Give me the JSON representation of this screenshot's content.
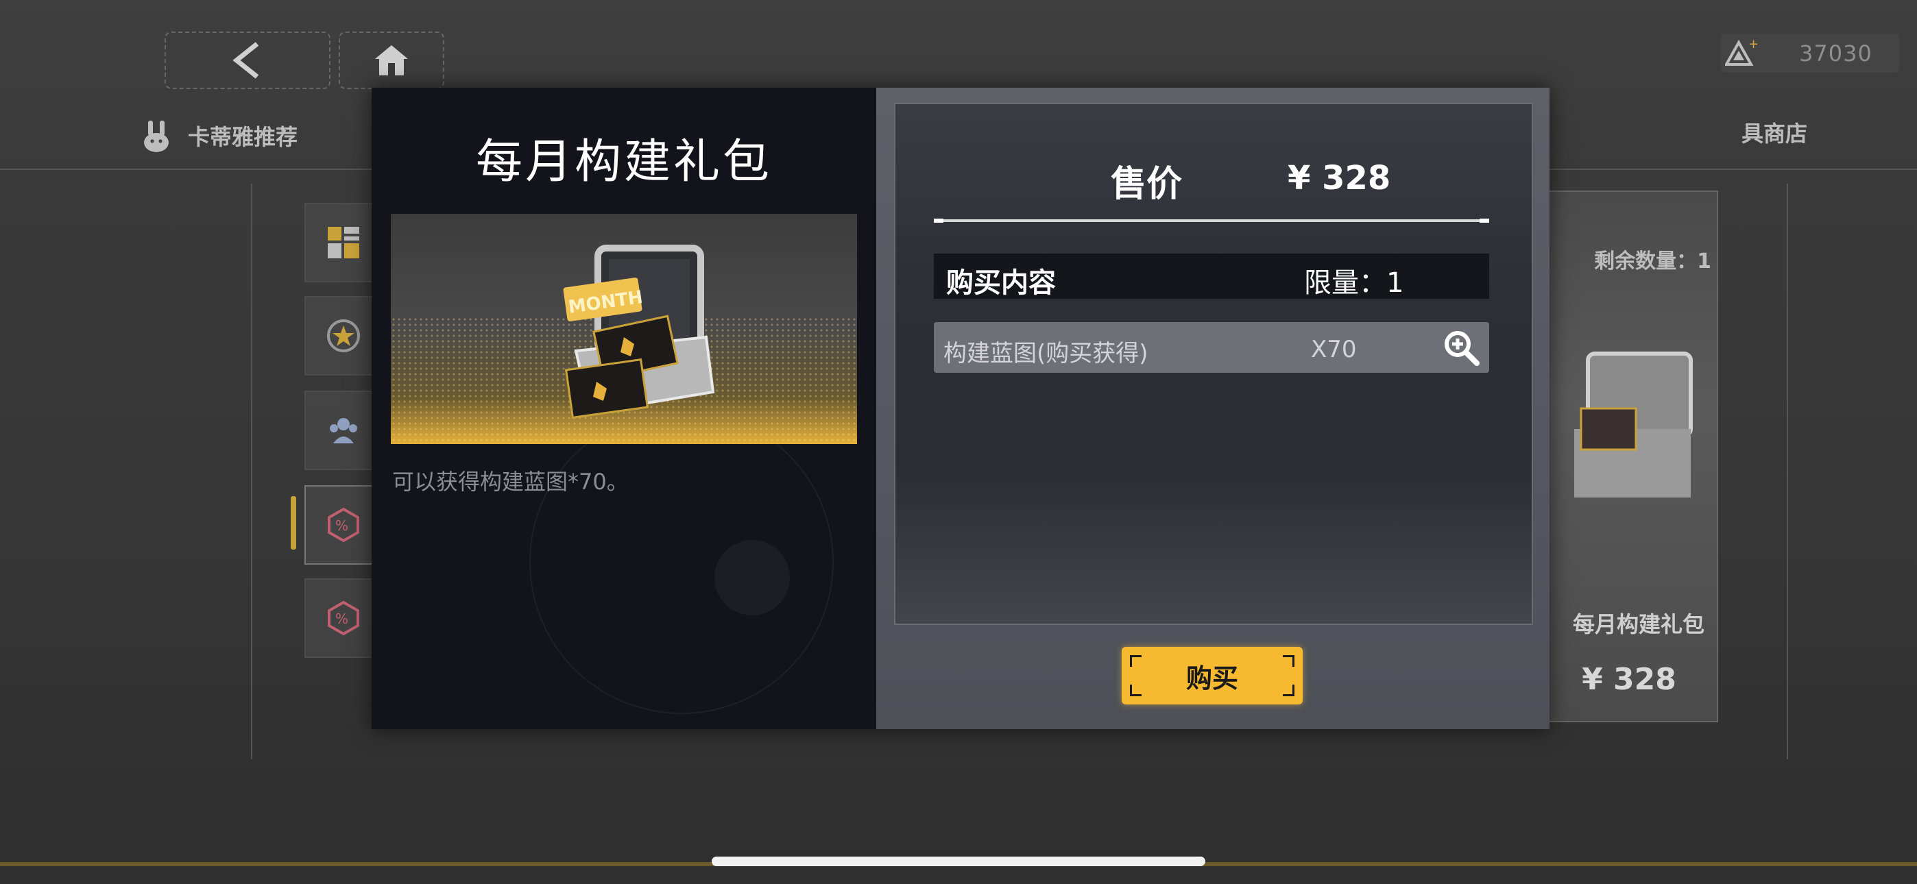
{
  "currency": {
    "amount": "37030",
    "icon": "triangle-token-icon"
  },
  "background": {
    "tab_left": "卡蒂雅推荐",
    "tab_right": "具商店",
    "card": {
      "remaining": "剩余数量：1",
      "name": "每月构建礼包",
      "price": "¥ 328"
    }
  },
  "modal": {
    "title": "每月构建礼包",
    "image_badge": "MONTH",
    "description": "可以获得构建蓝图*70。",
    "price_label": "售价",
    "price_value": "¥ 328",
    "contents_label": "购买内容",
    "limit_text": "限量：1",
    "item": {
      "name": "构建蓝图(购买获得)",
      "quantity": "X70"
    },
    "buy_label": "购买"
  },
  "colors": {
    "accent": "#f7b92f",
    "panel_dark": "#13131b",
    "panel_grey": "#545760"
  }
}
